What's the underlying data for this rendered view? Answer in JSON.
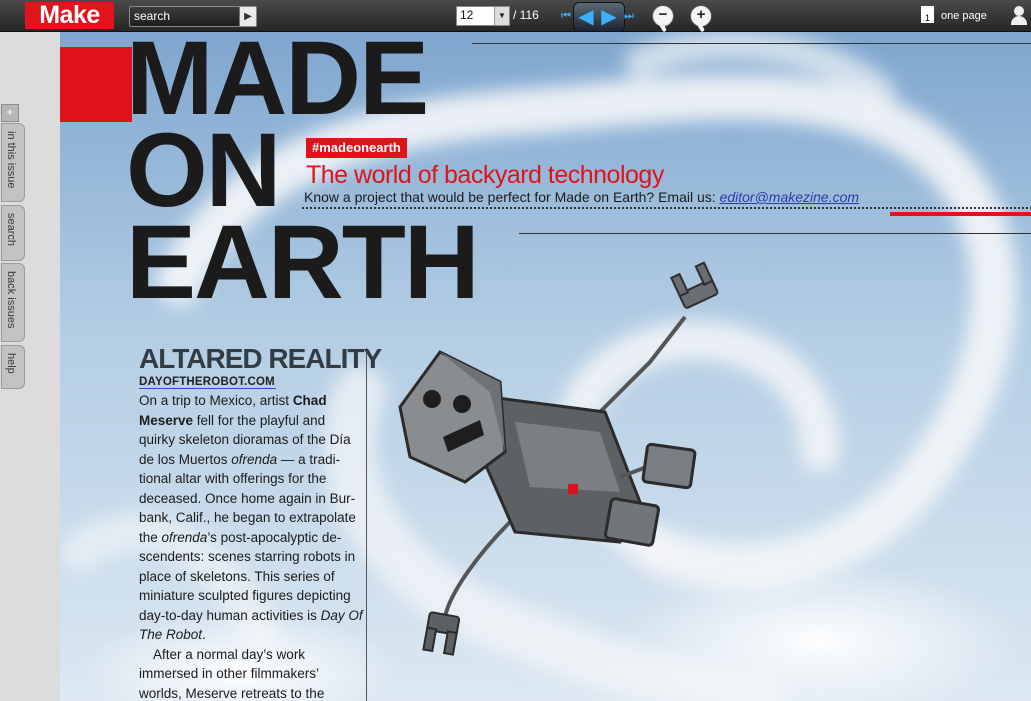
{
  "toolbar": {
    "logo": "Make",
    "search_placeholder": "search",
    "page_current": "12",
    "page_total": "/ 116",
    "view_mode": "one page",
    "icons": [
      "search-go-icon",
      "page-dropdown-arrow-icon",
      "first-page-icon",
      "prev-page-icon",
      "next-page-icon",
      "last-page-icon",
      "zoom-out-icon",
      "zoom-in-icon",
      "one-page-icon",
      "user-icon"
    ]
  },
  "sidebar": {
    "tabs": [
      {
        "label": "in this issue"
      },
      {
        "label": "search"
      },
      {
        "label": "back issues"
      },
      {
        "label": "help"
      }
    ],
    "expand_icon": "+"
  },
  "magazine": {
    "title_lines": [
      "MADE",
      "ON",
      "EARTH"
    ],
    "hashtag": "#madeonearth",
    "subtitle": "The world of backyard technology",
    "prompt_text": "Know a project that would be perfect for Made on Earth? Email us: ",
    "prompt_email": " editor@makezine.com ",
    "article": {
      "headline": "ALTARED REALITY",
      "url": "DAYOFTHEROBOT.COM",
      "p1_a": "On a trip to Mexico, artist ",
      "p1_name": "Chad Meserve",
      "p1_b": " fell for the playful and quirky skeleton dioramas of the Día de los Muertos ",
      "p1_ofrenda": "ofrenda",
      "p1_c": " — a tradi-tional altar with offerings for the deceased. Once home again in Bur-bank, Calif., he began to extrapolate the ",
      "p1_ofrenda2": "ofrenda",
      "p1_d": "’s post-apocalyptic de-scendents: scenes starring robots in place of skeletons. This series of miniature sculpted figures depicting day-to-day human activities is ",
      "p1_title": "Day Of The Robot",
      "p1_e": ".",
      "p2": "After a normal day’s work immersed in other filmmakers’ worlds, Meserve retreats to the"
    }
  },
  "colors": {
    "brand_red": "#e0131b",
    "link_blue": "#2e3aa8",
    "nav_blue": "#39b0ff"
  }
}
